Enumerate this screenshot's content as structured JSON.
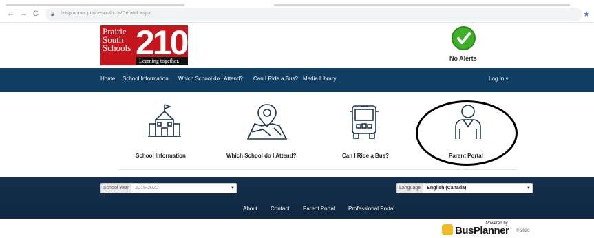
{
  "browser": {
    "url": "busplanner.prairiesouth.ca/Default.aspx",
    "nav_back": "←",
    "nav_forward": "→",
    "nav_reload": "C"
  },
  "header": {
    "logo_name_lines": [
      "Prairie",
      "South",
      "Schools"
    ],
    "logo_number": "210",
    "logo_tagline": "Learning together.",
    "alert_text": "No Alerts"
  },
  "navbar": {
    "items": [
      "Home",
      "School Information",
      "Which School do I Attend?",
      "Can I Ride a Bus?",
      "Media Library"
    ],
    "login": "Log In ▾"
  },
  "tiles": [
    {
      "label": "School Information",
      "icon": "school-building-icon"
    },
    {
      "label": "Which School do I Attend?",
      "icon": "map-pin-icon"
    },
    {
      "label": "Can I Ride a Bus?",
      "icon": "bus-icon"
    },
    {
      "label": "Parent Portal",
      "icon": "person-icon"
    }
  ],
  "footer": {
    "school_year_label": "School Year",
    "school_year_value": "2019-2020",
    "language_label": "Language",
    "language_value": "English (Canada)",
    "links": [
      "About",
      "Contact",
      "Parent Portal",
      "Professional Portal"
    ]
  },
  "branding": {
    "powered_by": "Powered by",
    "product": "BusPlanner",
    "copyright": "© 2020"
  },
  "colors": {
    "navbar": "#0f3e62",
    "footer": "#0f2841",
    "logo_red": "#c4161c",
    "alert_green": "#3fae29"
  }
}
